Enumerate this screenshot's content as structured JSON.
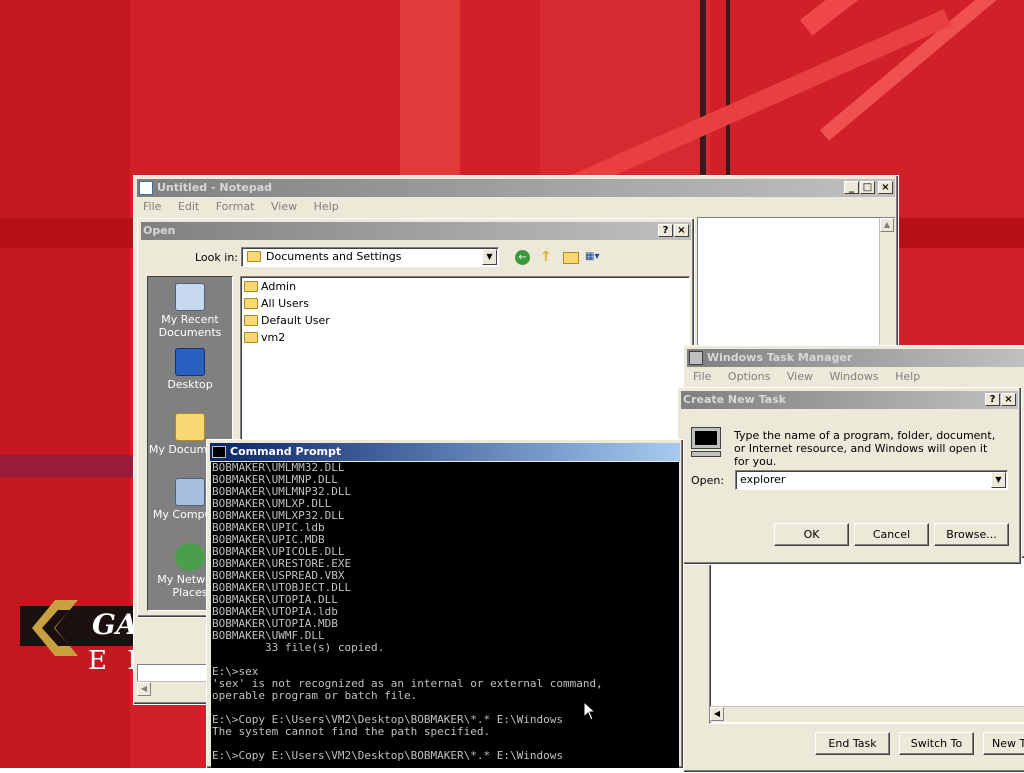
{
  "notepad": {
    "title": "Untitled - Notepad",
    "menu": [
      "File",
      "Edit",
      "Format",
      "View",
      "Help"
    ]
  },
  "open_dialog": {
    "title": "Open",
    "look_in_label": "Look in:",
    "look_in_value": "Documents and Settings",
    "folders": [
      "Admin",
      "All Users",
      "Default User",
      "vm2"
    ],
    "places": [
      "My Recent Documents",
      "Desktop",
      "My Documents",
      "My Computer",
      "My Network Places"
    ]
  },
  "cmd": {
    "title": "Command Prompt",
    "lines": [
      "BOBMAKER\\UMLMM32.DLL",
      "BOBMAKER\\UMLMNP.DLL",
      "BOBMAKER\\UMLMNP32.DLL",
      "BOBMAKER\\UMLXP.DLL",
      "BOBMAKER\\UMLXP32.DLL",
      "BOBMAKER\\UPIC.ldb",
      "BOBMAKER\\UPIC.MDB",
      "BOBMAKER\\UPICOLE.DLL",
      "BOBMAKER\\URESTORE.EXE",
      "BOBMAKER\\USPREAD.VBX",
      "BOBMAKER\\UTOBJECT.DLL",
      "BOBMAKER\\UTOPIA.DLL",
      "BOBMAKER\\UTOPIA.ldb",
      "BOBMAKER\\UTOPIA.MDB",
      "BOBMAKER\\UWMF.DLL",
      "        33 file(s) copied.",
      "",
      "E:\\>sex",
      "'sex' is not recognized as an internal or external command,",
      "operable program or batch file.",
      "",
      "E:\\>Copy E:\\Users\\VM2\\Desktop\\BOBMAKER\\*.* E:\\Windows",
      "The system cannot find the path specified.",
      "",
      "E:\\>Copy E:\\Users\\VM2\\Desktop\\BOBMAKER\\*.* E:\\Windows"
    ]
  },
  "task_manager": {
    "title": "Windows Task Manager",
    "menu": [
      "File",
      "Options",
      "View",
      "Windows",
      "Help"
    ],
    "buttons": {
      "end_task": "End Task",
      "switch_to": "Switch To",
      "new_task": "New Task..."
    }
  },
  "create_task": {
    "title": "Create New Task",
    "prompt": "Type the name of a program, folder, document, or Internet resource, and Windows will open it for you.",
    "open_label": "Open:",
    "open_value": "explorer",
    "buttons": {
      "ok": "OK",
      "cancel": "Cancel",
      "browse": "Browse..."
    }
  },
  "logo": {
    "text1": "GA",
    "text2": "E I"
  },
  "colors": {
    "desktop_red": "#d0202a",
    "title_active": "#0a246a",
    "title_inactive": "#808080"
  }
}
